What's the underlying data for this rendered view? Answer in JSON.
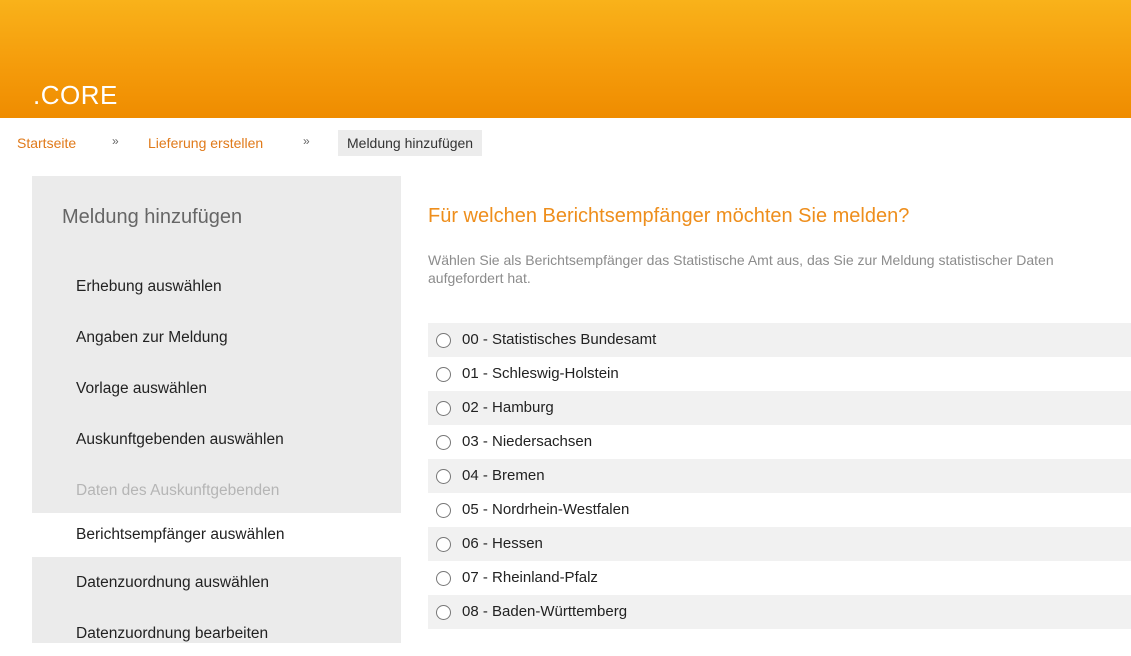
{
  "header": {
    "brand": ".CORE",
    "color": "#f5a00f"
  },
  "breadcrumb": {
    "items": [
      {
        "label": "Startseite"
      },
      {
        "label": "Lieferung erstellen"
      }
    ],
    "separator": "»",
    "current": "Meldung hinzufügen"
  },
  "sidebar": {
    "title": "Meldung hinzufügen",
    "items": [
      {
        "label": "Erhebung auswählen",
        "state": "enabled"
      },
      {
        "label": "Angaben zur Meldung",
        "state": "enabled"
      },
      {
        "label": "Vorlage auswählen",
        "state": "enabled"
      },
      {
        "label": "Auskunftgebenden auswählen",
        "state": "enabled"
      },
      {
        "label": "Daten des Auskunftgebenden",
        "state": "disabled"
      },
      {
        "label": "Berichtsempfänger auswählen",
        "state": "active"
      },
      {
        "label": "Datenzuordnung auswählen",
        "state": "enabled"
      },
      {
        "label": "Datenzuordnung bearbeiten",
        "state": "enabled"
      }
    ]
  },
  "main": {
    "question": "Für welchen Berichtsempfänger möchten Sie melden?",
    "hint": "Wählen Sie als Berichtsempfänger das Statistische Amt aus, das Sie zur Meldung statistischer Daten aufgefordert hat.",
    "options": [
      "00 - Statistisches Bundesamt",
      "01 - Schleswig-Holstein",
      "02 - Hamburg",
      "03 - Niedersachsen",
      "04 - Bremen",
      "05 - Nordrhein-Westfalen",
      "06 - Hessen",
      "07 - Rheinland-Pfalz",
      "08 - Baden-Württemberg"
    ]
  }
}
